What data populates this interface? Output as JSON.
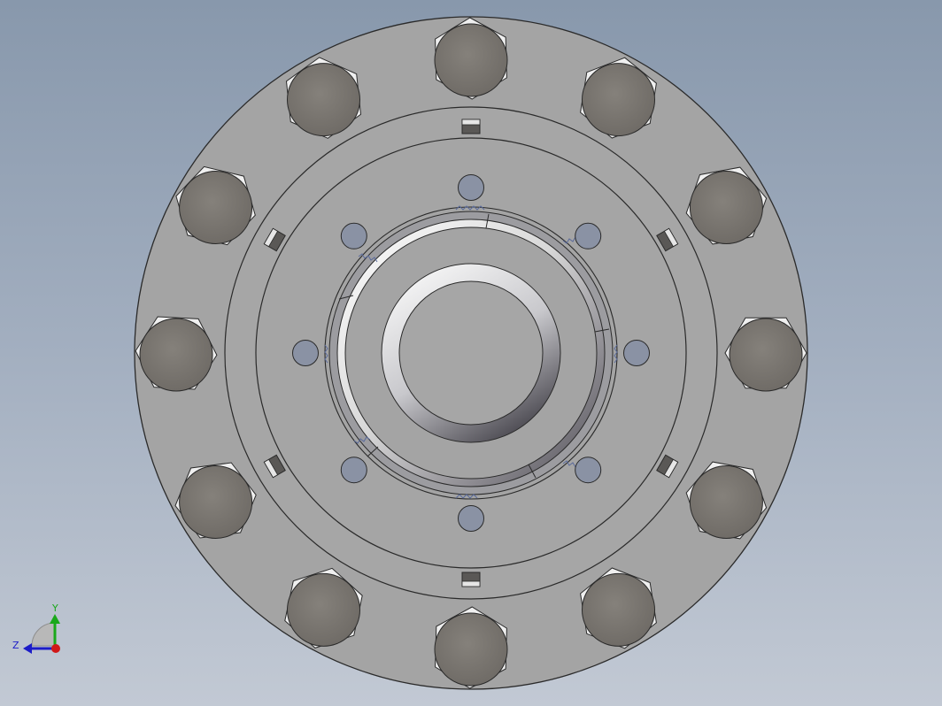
{
  "viewport": {
    "background_top": "#8898ac",
    "background_bottom": "#c2c9d4"
  },
  "model": {
    "flange_color": "#a4a4a4",
    "edge_color": "#2a2a2a",
    "bolt_head_color": "#7a7670",
    "bolt_hex_color": "#efefef",
    "pin_hole_color": "#8a92a4",
    "bolt_count": 12,
    "pin_hole_count": 8,
    "set_screw_count": 6
  },
  "triad": {
    "y_label": "Y",
    "z_label": "Z",
    "y_color": "#1aa81a",
    "z_color": "#1c1cc8",
    "x_color": "#d01818"
  }
}
